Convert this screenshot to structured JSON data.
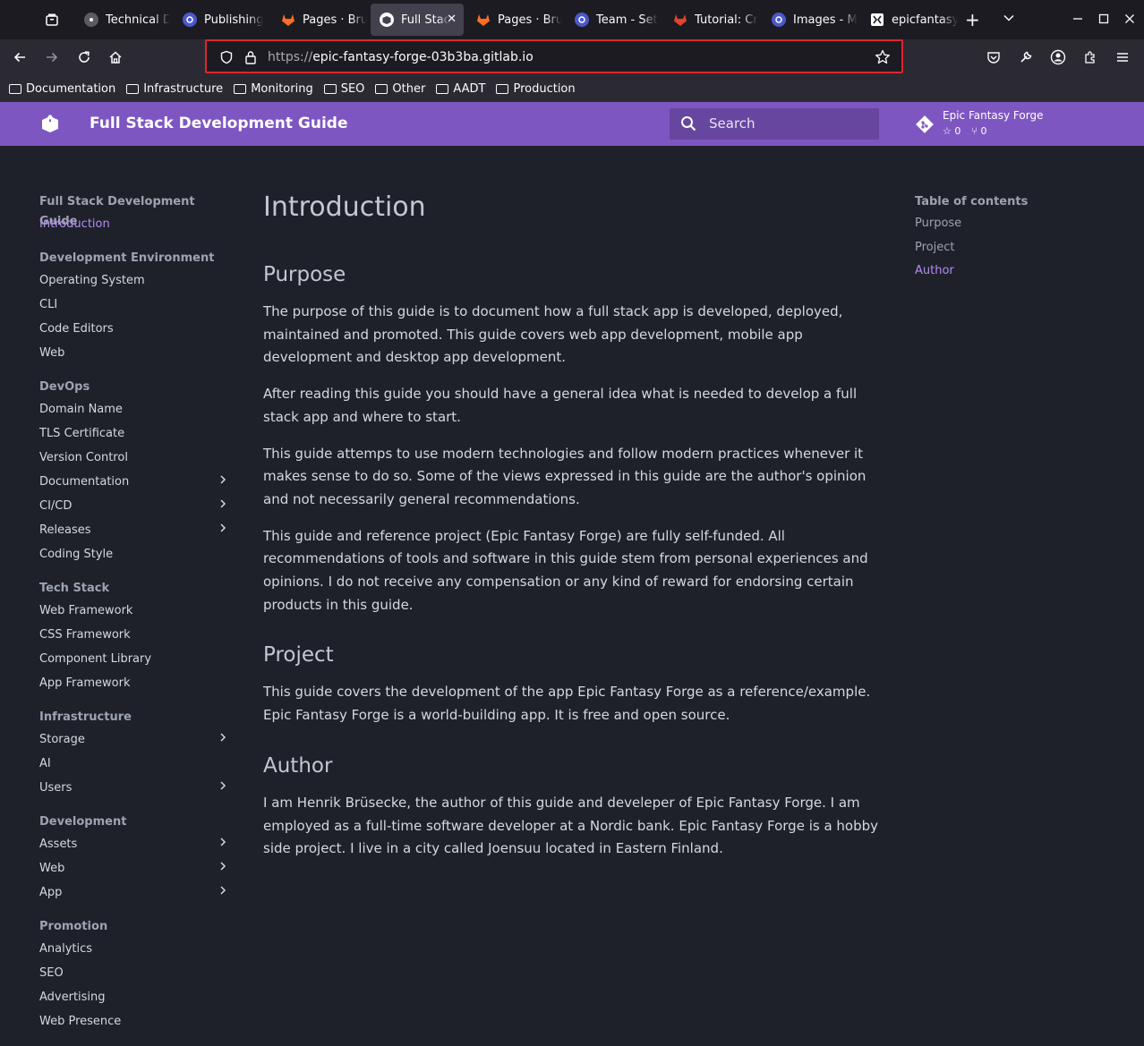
{
  "browser": {
    "tabs": [
      {
        "title": "Technical D",
        "favicon": "globe-icon",
        "active": false
      },
      {
        "title": "Publishing",
        "favicon": "blue-app-icon",
        "active": false
      },
      {
        "title": "Pages · Bru",
        "favicon": "gitlab-icon",
        "active": false
      },
      {
        "title": "Full Stac",
        "favicon": "site-logo-icon",
        "active": true
      },
      {
        "title": "Pages · Bru",
        "favicon": "gitlab-icon",
        "active": false
      },
      {
        "title": "Team - Set",
        "favicon": "blue-app-icon",
        "active": false
      },
      {
        "title": "Tutorial: Cr",
        "favicon": "gitlab-orange-icon",
        "active": false
      },
      {
        "title": "Images - M",
        "favicon": "blue-app-icon",
        "active": false
      },
      {
        "title": "epicfantasy",
        "favicon": "epic-icon",
        "active": false
      }
    ],
    "url_scheme": "https://",
    "url_host": "epic-fantasy-forge-03b3ba.gitlab.io",
    "bookmarks": [
      "Documentation",
      "Infrastructure",
      "Monitoring",
      "SEO",
      "Other",
      "AADT",
      "Production"
    ]
  },
  "header": {
    "title": "Full Stack Development Guide",
    "search_placeholder": "Search",
    "repo_name": "Epic Fantasy Forge",
    "stars": "0",
    "forks": "0",
    "accent": "#7e56c2"
  },
  "sidebar": {
    "sections": [
      {
        "heading": "Full Stack Development Guide",
        "items": [
          {
            "label": "Introduction",
            "active": true,
            "expandable": false
          }
        ]
      },
      {
        "heading": "Development Environment",
        "items": [
          {
            "label": "Operating System",
            "expandable": false
          },
          {
            "label": "CLI",
            "expandable": false
          },
          {
            "label": "Code Editors",
            "expandable": false
          },
          {
            "label": "Web",
            "expandable": false
          }
        ]
      },
      {
        "heading": "DevOps",
        "items": [
          {
            "label": "Domain Name",
            "expandable": false
          },
          {
            "label": "TLS Certificate",
            "expandable": false
          },
          {
            "label": "Version Control",
            "expandable": false
          },
          {
            "label": "Documentation",
            "expandable": true
          },
          {
            "label": "CI/CD",
            "expandable": true
          },
          {
            "label": "Releases",
            "expandable": true
          },
          {
            "label": "Coding Style",
            "expandable": false
          }
        ]
      },
      {
        "heading": "Tech Stack",
        "items": [
          {
            "label": "Web Framework",
            "expandable": false
          },
          {
            "label": "CSS Framework",
            "expandable": false
          },
          {
            "label": "Component Library",
            "expandable": false
          },
          {
            "label": "App Framework",
            "expandable": false
          }
        ]
      },
      {
        "heading": "Infrastructure",
        "items": [
          {
            "label": "Storage",
            "expandable": true
          },
          {
            "label": "AI",
            "expandable": false
          },
          {
            "label": "Users",
            "expandable": true
          }
        ]
      },
      {
        "heading": "Development",
        "items": [
          {
            "label": "Assets",
            "expandable": true
          },
          {
            "label": "Web",
            "expandable": true
          },
          {
            "label": "App",
            "expandable": true
          }
        ]
      },
      {
        "heading": "Promotion",
        "items": [
          {
            "label": "Analytics",
            "expandable": false
          },
          {
            "label": "SEO",
            "expandable": false
          },
          {
            "label": "Advertising",
            "expandable": false
          },
          {
            "label": "Web Presence",
            "expandable": false
          }
        ]
      }
    ]
  },
  "content": {
    "title": "Introduction",
    "sections": [
      {
        "heading": "Purpose",
        "paragraphs": [
          "The purpose of this guide is to document how a full stack app is developed, deployed, maintained and promoted. This guide covers web app development, mobile app development and desktop app development.",
          "After reading this guide you should have a general idea what is needed to develop a full stack app and where to start.",
          "This guide attemps to use modern technologies and follow modern practices whenever it makes sense to do so. Some of the views expressed in this guide are the author's opinion and not necessarily general recommendations.",
          "This guide and reference project (Epic Fantasy Forge) are fully self-funded. All recommendations of tools and software in this guide stem from personal experiences and opinions. I do not receive any compensation or any kind of reward for endorsing certain products in this guide."
        ]
      },
      {
        "heading": "Project",
        "paragraphs": [
          "This guide covers the development of the app Epic Fantasy Forge as a reference/example. Epic Fantasy Forge is a world-building app. It is free and open source."
        ]
      },
      {
        "heading": "Author",
        "paragraphs": [
          "I am Henrik Brüsecke, the author of this guide and develeper of Epic Fantasy Forge. I am employed as a full-time software developer at a Nordic bank. Epic Fantasy Forge is a hobby side project. I live in a city called Joensuu located in Eastern Finland."
        ]
      }
    ]
  },
  "toc": {
    "heading": "Table of contents",
    "items": [
      {
        "label": "Purpose",
        "active": false
      },
      {
        "label": "Project",
        "active": false
      },
      {
        "label": "Author",
        "active": true
      }
    ]
  }
}
